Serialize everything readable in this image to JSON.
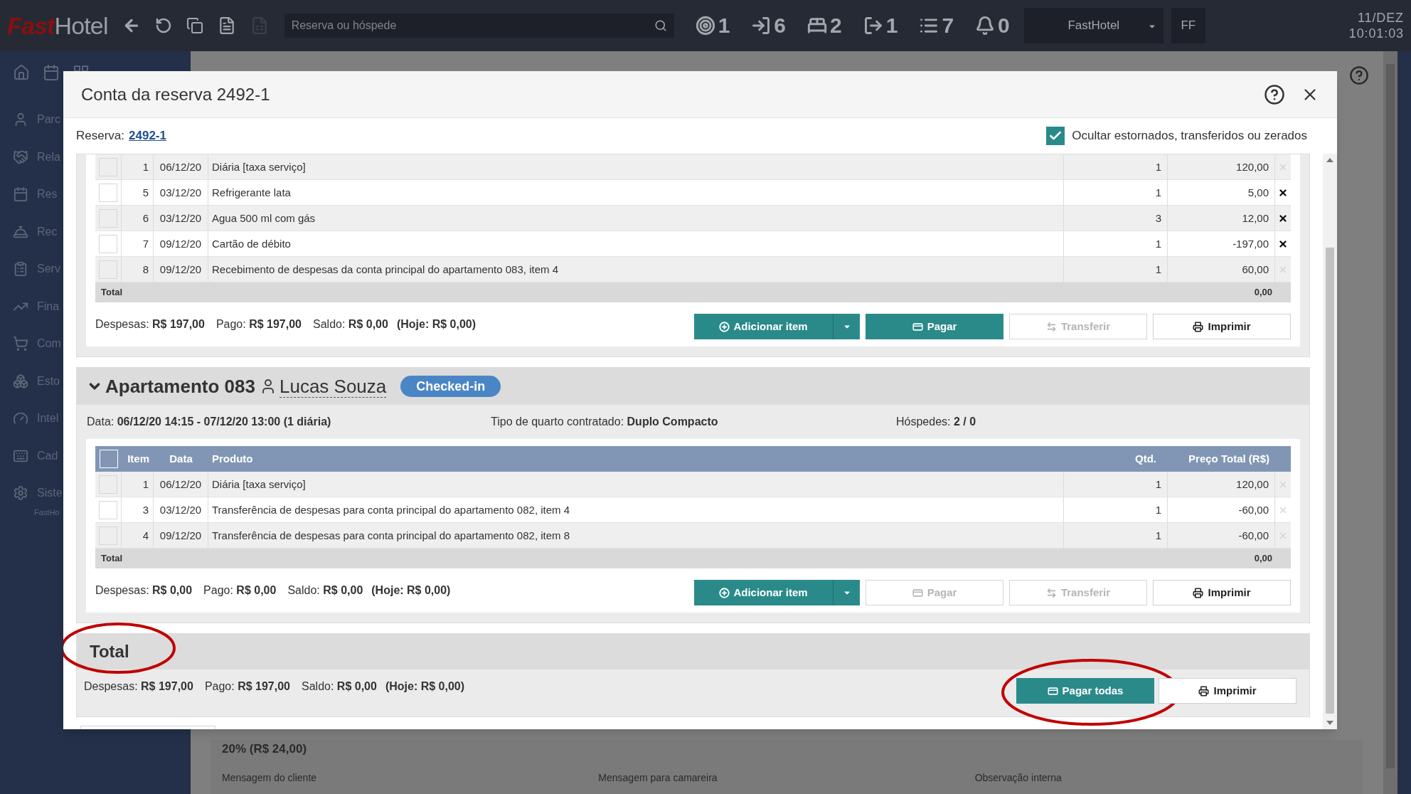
{
  "topbar": {
    "logo": {
      "first": "Fast",
      "second": "Hotel"
    },
    "search": {
      "placeholder": "Reserva ou hóspede"
    },
    "counters": [
      {
        "kind": "target",
        "value": "1"
      },
      {
        "kind": "arrivals",
        "value": "6"
      },
      {
        "kind": "bed",
        "value": "2"
      },
      {
        "kind": "departures",
        "value": "1"
      },
      {
        "kind": "list",
        "value": "7"
      },
      {
        "kind": "bell",
        "value": "0"
      }
    ],
    "hotel_select": "FastHotel",
    "user": "FF",
    "date": "11/DEZ",
    "time": "10:01:03"
  },
  "sidebar": {
    "items": [
      {
        "kind": "user",
        "label": "Parc"
      },
      {
        "kind": "handshake",
        "label": "Rela"
      },
      {
        "kind": "calendar",
        "label": "Res"
      },
      {
        "kind": "bell",
        "label": "Rec"
      },
      {
        "kind": "service",
        "label": "Serv"
      },
      {
        "kind": "chart",
        "label": "Fina"
      },
      {
        "kind": "cart",
        "label": "Com"
      },
      {
        "kind": "boxes",
        "label": "Esto"
      },
      {
        "kind": "gauge",
        "label": "Intel"
      },
      {
        "kind": "keyboard",
        "label": "Cad"
      },
      {
        "kind": "gear",
        "label": "Siste"
      }
    ],
    "footer": "FastHo"
  },
  "page": {
    "commission": "20% (R$ 24,00)",
    "labels": [
      "Mensagem do cliente",
      "Mensagem para camareira",
      "Observação interna"
    ]
  },
  "modal": {
    "title": "Conta da reserva 2492-1",
    "reserva_label": "Reserva:",
    "reserva_link": "2492-1",
    "hide_option": {
      "label": "Ocultar estornados, transferidos ou zerados",
      "checked": true
    },
    "accounts": [
      {
        "rows": [
          {
            "item": "1",
            "date": "06/12/20",
            "product": "Diária [taxa serviço]",
            "qty": "1",
            "price": "120,00",
            "removable": false,
            "checked": false
          },
          {
            "item": "5",
            "date": "03/12/20",
            "product": "Refrigerante lata",
            "qty": "1",
            "price": "5,00",
            "removable": true,
            "checked": false
          },
          {
            "item": "6",
            "date": "03/12/20",
            "product": "Agua 500 ml com gás",
            "qty": "3",
            "price": "12,00",
            "removable": true,
            "checked": false
          },
          {
            "item": "7",
            "date": "09/12/20",
            "product": "Cartão de débito",
            "qty": "1",
            "price": "-197,00",
            "removable": true,
            "checked": false
          },
          {
            "item": "8",
            "date": "09/12/20",
            "product": "Recebimento de despesas da conta principal do apartamento 083, item 4",
            "qty": "1",
            "price": "60,00",
            "removable": false,
            "checked": false
          }
        ],
        "total_label": "Total",
        "total": "0,00",
        "summary": {
          "items": [
            {
              "label": "Despesas:",
              "value": "R$ 197,00"
            },
            {
              "label": "Pago:",
              "value": "R$ 197,00"
            },
            {
              "label": "Saldo:",
              "value": "R$ 0,00"
            }
          ],
          "today": "(Hoje: R$ 0,00)"
        },
        "buttons": [
          {
            "kind": "add",
            "label": "Adicionar item",
            "disabled": false
          },
          {
            "kind": "pay",
            "label": "Pagar",
            "disabled": false
          },
          {
            "kind": "transfer",
            "label": "Transferir",
            "disabled": true
          },
          {
            "kind": "print",
            "label": "Imprimir",
            "disabled": false
          }
        ]
      },
      {
        "apartment": {
          "title": "Apartamento 083",
          "guest": "Lucas Souza",
          "status": "Checked-in",
          "expanded": true,
          "info": [
            {
              "label": "Data:",
              "value": "06/12/20 14:15 - 07/12/20 13:00 (1 diária)"
            },
            {
              "label": "Tipo de quarto contratado:",
              "value": "Duplo Compacto"
            },
            {
              "label": "Hóspedes:",
              "value": "2 / 0"
            }
          ]
        },
        "select_all": {
          "checked": false
        },
        "columns": [
          "Item",
          "Data",
          "Produto",
          "Qtd.",
          "Preço Total (R$)"
        ],
        "rows": [
          {
            "item": "1",
            "date": "06/12/20",
            "product": "Diária [taxa serviço]",
            "qty": "1",
            "price": "120,00",
            "removable": false,
            "checked": false
          },
          {
            "item": "3",
            "date": "03/12/20",
            "product": "Transferência de despesas para conta principal do apartamento 082, item 4",
            "qty": "1",
            "price": "-60,00",
            "removable": false,
            "checked": false
          },
          {
            "item": "4",
            "date": "09/12/20",
            "product": "Transferência de despesas para conta principal do apartamento 082, item 8",
            "qty": "1",
            "price": "-60,00",
            "removable": false,
            "checked": false
          }
        ],
        "total_label": "Total",
        "total": "0,00",
        "summary": {
          "items": [
            {
              "label": "Despesas:",
              "value": "R$ 0,00"
            },
            {
              "label": "Pago:",
              "value": "R$ 0,00"
            },
            {
              "label": "Saldo:",
              "value": "R$ 0,00"
            }
          ],
          "today": "(Hoje: R$ 0,00)"
        },
        "buttons": [
          {
            "kind": "add",
            "label": "Adicionar item",
            "disabled": false
          },
          {
            "kind": "pay",
            "label": "Pagar",
            "disabled": true
          },
          {
            "kind": "transfer",
            "label": "Transferir",
            "disabled": true
          },
          {
            "kind": "print",
            "label": "Imprimir",
            "disabled": false
          }
        ]
      }
    ],
    "grand_total": {
      "title": "Total",
      "summary": {
        "items": [
          {
            "label": "Despesas:",
            "value": "R$ 197,00"
          },
          {
            "label": "Pago:",
            "value": "R$ 197,00"
          },
          {
            "label": "Saldo:",
            "value": "R$ 0,00"
          }
        ],
        "today": "(Hoje: R$ 0,00)"
      },
      "buttons": [
        {
          "kind": "pay_all",
          "label": "Pagar todas",
          "disabled": false
        },
        {
          "kind": "print",
          "label": "Imprimir",
          "disabled": false
        }
      ]
    }
  }
}
